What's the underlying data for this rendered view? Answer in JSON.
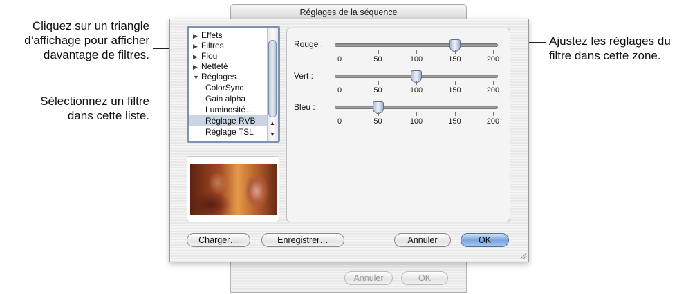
{
  "window": {
    "title": "Réglages de la séquence"
  },
  "callouts": {
    "triangle": [
      "Cliquez sur un triangle",
      "d’affichage pour afficher",
      "davantage de filtres."
    ],
    "liste": [
      "Sélectionnez un filtre",
      "dans cette liste."
    ],
    "zone": [
      "Ajustez les réglages du",
      "filtre dans cette zone."
    ]
  },
  "filter_list": {
    "items": [
      {
        "label": "Effets",
        "expanded": false
      },
      {
        "label": "Filtres",
        "expanded": false
      },
      {
        "label": "Flou",
        "expanded": false
      },
      {
        "label": "Netteté",
        "expanded": false
      },
      {
        "label": "Réglages",
        "expanded": true
      }
    ],
    "children": [
      "ColorSync",
      "Gain alpha",
      "Luminosité…",
      "Réglage RVB",
      "Réglage TSL"
    ],
    "selected": "Réglage RVB",
    "expander_closed": "▶",
    "expander_open": "▼"
  },
  "sliders": [
    {
      "label": "Rouge :",
      "value": 150
    },
    {
      "label": "Vert :",
      "value": 100
    },
    {
      "label": "Bleu :",
      "value": 50
    }
  ],
  "slider_scale": {
    "min": 0,
    "max": 200,
    "ticks": [
      "0",
      "50",
      "100",
      "150",
      "200"
    ]
  },
  "buttons": {
    "load": "Charger…",
    "save": "Enregistrer…",
    "cancel": "Annuler",
    "ok": "OK"
  },
  "background_buttons": {
    "cancel": "Annuler",
    "ok": "OK"
  },
  "colors": {
    "selection": "#c9d4e4",
    "default_button": "#7aa4de",
    "list_focus_ring": "#7d93b3"
  },
  "icons": {
    "scroll_up": "triangle-up-icon",
    "scroll_down": "triangle-down-icon",
    "resize": "resize-grip-icon"
  }
}
